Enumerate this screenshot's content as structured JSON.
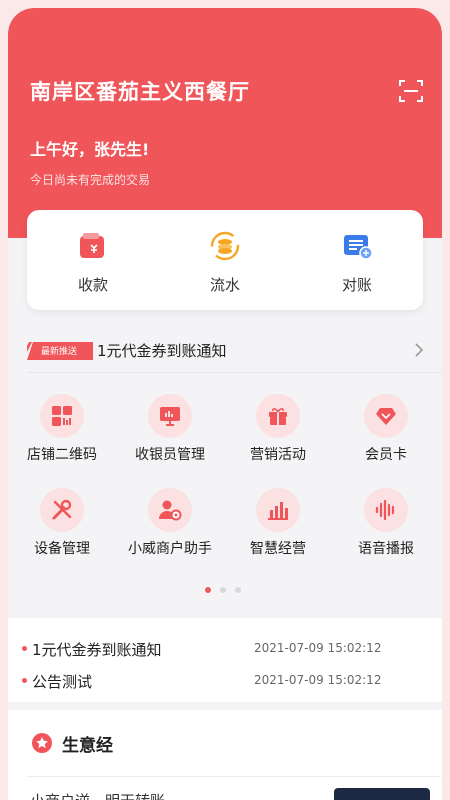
{
  "header": {
    "store_name": "南岸区番茄主义西餐厅",
    "greeting": "上午好，张先生!",
    "subtitle": "今日尚未有完成的交易"
  },
  "quick_actions": [
    {
      "label": "收款",
      "icon": "wallet-icon"
    },
    {
      "label": "流水",
      "icon": "coins-flow-icon"
    },
    {
      "label": "对账",
      "icon": "reconcile-icon"
    }
  ],
  "promo": {
    "tag": "最新推送",
    "text": "1元代金券到账通知"
  },
  "grid": [
    {
      "label": "店铺二维码",
      "icon": "qr-grid-icon"
    },
    {
      "label": "收银员管理",
      "icon": "monitor-icon"
    },
    {
      "label": "营销活动",
      "icon": "gift-icon"
    },
    {
      "label": "会员卡",
      "icon": "diamond-icon"
    },
    {
      "label": "设备管理",
      "icon": "tools-icon"
    },
    {
      "label": "小威商户助手",
      "icon": "user-gear-icon"
    },
    {
      "label": "智慧经营",
      "icon": "bar-chart-icon"
    },
    {
      "label": "语音播报",
      "icon": "soundwave-icon"
    }
  ],
  "notices": [
    {
      "title": "1元代金券到账通知",
      "time": "2021-07-09 15:02:12"
    },
    {
      "title": "公告测试",
      "time": "2021-07-09 15:02:12"
    }
  ],
  "business": {
    "title": "生意经",
    "article": "小商户逆…明天转账"
  },
  "colors": {
    "accent": "#f0555a",
    "icon_bg": "#fbe1e1",
    "flow": "#f5a623",
    "reconcile": "#3b7de8"
  }
}
